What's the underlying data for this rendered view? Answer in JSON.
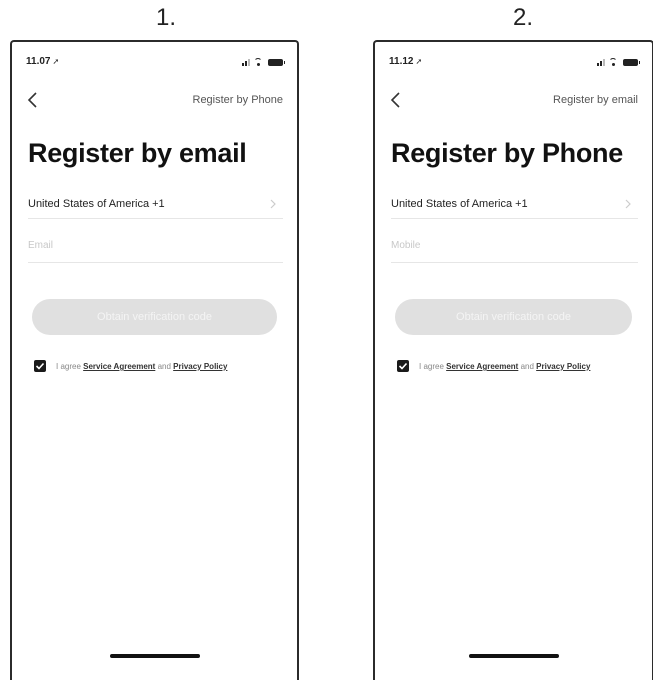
{
  "screens": [
    {
      "step_label": "1.",
      "status_time": "11.07",
      "nav_link": "Register by Phone",
      "title": "Register by email",
      "country": "United States of America +1",
      "field_placeholder": "Email",
      "button_label": "Obtain verification code",
      "agree_prefix": "I agree",
      "service_agreement": "Service Agreement",
      "agree_and": "and",
      "privacy_policy": "Privacy Policy",
      "checkbox_checked": true
    },
    {
      "step_label": "2.",
      "status_time": "11.12",
      "nav_link": "Register by email",
      "title": "Register by Phone",
      "country": "United States of America +1",
      "field_placeholder": "Mobile",
      "button_label": "Obtain verification code",
      "agree_prefix": "I agree",
      "service_agreement": "Service Agreement",
      "agree_and": "and",
      "privacy_policy": "Privacy Policy",
      "checkbox_checked": true
    }
  ],
  "icons": {
    "status_arrow": "location-arrow-icon",
    "signal": "signal-icon",
    "wifi": "wifi-icon",
    "battery": "battery-icon",
    "back": "back-chevron-icon",
    "chevron": "chevron-right-icon",
    "checkbox": "checkbox-checked-icon"
  },
  "colors": {
    "button_disabled_bg": "#e0e0e0",
    "button_disabled_text": "#f4f4f4",
    "checkbox": "#1a1a1a",
    "phone_frame": "#2b2b2b"
  }
}
